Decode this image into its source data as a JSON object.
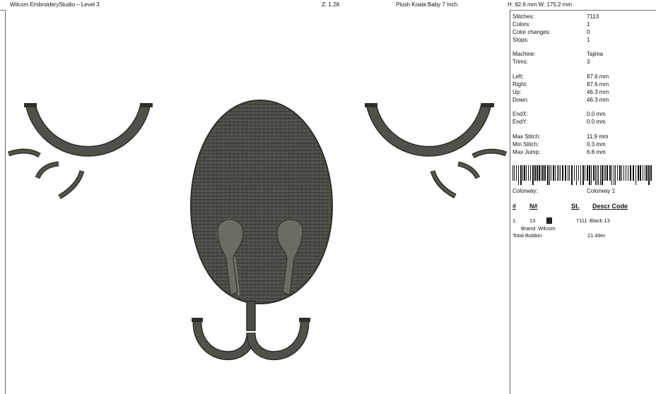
{
  "titlebar": {
    "app_title": "Wilcom EmbroideryStudio – Level 3",
    "zoom": "Z: 1.28",
    "design_name": "Plush Koala Baby 7 Inch",
    "dimensions": "H: 92.6 mm   W: 175.2 mm"
  },
  "stats": {
    "stitches": {
      "label": "Stitches:",
      "value": "7113"
    },
    "colors": {
      "label": "Colors:",
      "value": "1"
    },
    "color_changes": {
      "label": "Color changes:",
      "value": "0"
    },
    "stops": {
      "label": "Stops:",
      "value": "1"
    },
    "machine": {
      "label": "Machine:",
      "value": "Tajima"
    },
    "trims": {
      "label": "Trims:",
      "value": "3"
    },
    "left": {
      "label": "Left:",
      "value": "87.6 mm"
    },
    "right": {
      "label": "Right:",
      "value": "87.6 mm"
    },
    "up": {
      "label": "Up:",
      "value": "46.3 mm"
    },
    "down": {
      "label": "Down:",
      "value": "46.3 mm"
    },
    "endx": {
      "label": "EndX:",
      "value": "0.0 mm"
    },
    "endy": {
      "label": "EndY:",
      "value": "0.0 mm"
    },
    "max_stitch": {
      "label": "Max Stitch:",
      "value": "11.9 mm"
    },
    "min_stitch": {
      "label": "Min Stitch:",
      "value": "0.3 mm"
    },
    "max_jump": {
      "label": "Max Jump:",
      "value": "6.8 mm"
    },
    "colorway": {
      "label": "Colorway:",
      "value": "Colorway 1"
    }
  },
  "color_table": {
    "headers": {
      "idx": "#",
      "n": "N#",
      "st": "St.",
      "descr": "Descr  Code"
    },
    "rows": [
      {
        "idx": "1.",
        "n": "13",
        "swatch_color": "#222222",
        "st": "7111",
        "descr": "Black 13",
        "brand": "Brand: Wilcom"
      }
    ],
    "total_bobbin": {
      "label": "Total Bobbin:",
      "value": "21.49m"
    }
  },
  "colors": {
    "thread": "#4a4a44",
    "thread_dark": "#2e2e2a",
    "thread_light": "#77776d"
  }
}
